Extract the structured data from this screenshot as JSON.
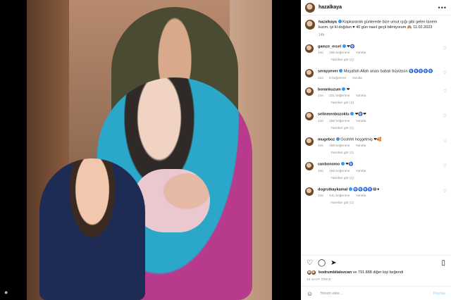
{
  "post": {
    "username": "hazalkaya",
    "more_icon": "more-horizontal-icon",
    "caption": "Kapkaranlık günlerede bize umut ışığı gibi gelen tanem kızım. iyi ki doğdun ♥ 40 gün nasıl geçti bilmiyorum 🙈 11.02.2023",
    "caption_time": "14h"
  },
  "comments": [
    {
      "user": "gamze_ercel",
      "text": "❤🧿",
      "time": "14s",
      "likes": "295 beğenme",
      "reply": "Yanıtla",
      "replies": "Yanıtları gör (1)"
    },
    {
      "user": "serayyever",
      "text": "Maşallah Allah anası babalı büyütsün 🧿🧿🧿🧿🧿",
      "time": "12s",
      "likes": "8 beğenme",
      "reply": "Yanıtla",
      "replies": ""
    },
    {
      "user": "borankuzum",
      "text": "❤",
      "time": "14s",
      "likes": "221 beğenme",
      "reply": "Yanıtla",
      "replies": "Yanıtları gör (1)"
    },
    {
      "user": "selinmenbozoklu",
      "text": "❤🧿❤",
      "time": "14s",
      "likes": "186 beğenme",
      "reply": "Yanıtla",
      "replies": "Yanıtları gör (1)"
    },
    {
      "user": "mugeboz",
      "text": "Ocohhh hoşgelmiş ❤🥰",
      "time": "14s",
      "likes": "198 beğenme",
      "reply": "Yanıtla",
      "replies": "Yanıtları gör (1)"
    },
    {
      "user": "canbonomo",
      "text": "❤🧿",
      "time": "14s",
      "likes": "166 beğenme",
      "reply": "Yanıtla",
      "replies": "Yanıtları gör (1)"
    },
    {
      "user": "dogrutkaykamal",
      "text": "🧿🧿🧿🧿😂♥",
      "time": "14s",
      "likes": "141 beğenme",
      "reply": "Yanıtla",
      "replies": "Yanıtları gör (1)"
    }
  ],
  "actions": {
    "like_icon": "heart-icon",
    "comment_icon": "comment-icon",
    "share_icon": "send-icon",
    "save_icon": "bookmark-icon"
  },
  "likes": {
    "first_user": "bodrumbilalozcan",
    "rest": "ve 791.888 diğer kişi beğendi"
  },
  "date": "14 SAAT ÖNCE",
  "add_comment": {
    "placeholder": "Yorum ekle...",
    "post_label": "Paylaş"
  }
}
